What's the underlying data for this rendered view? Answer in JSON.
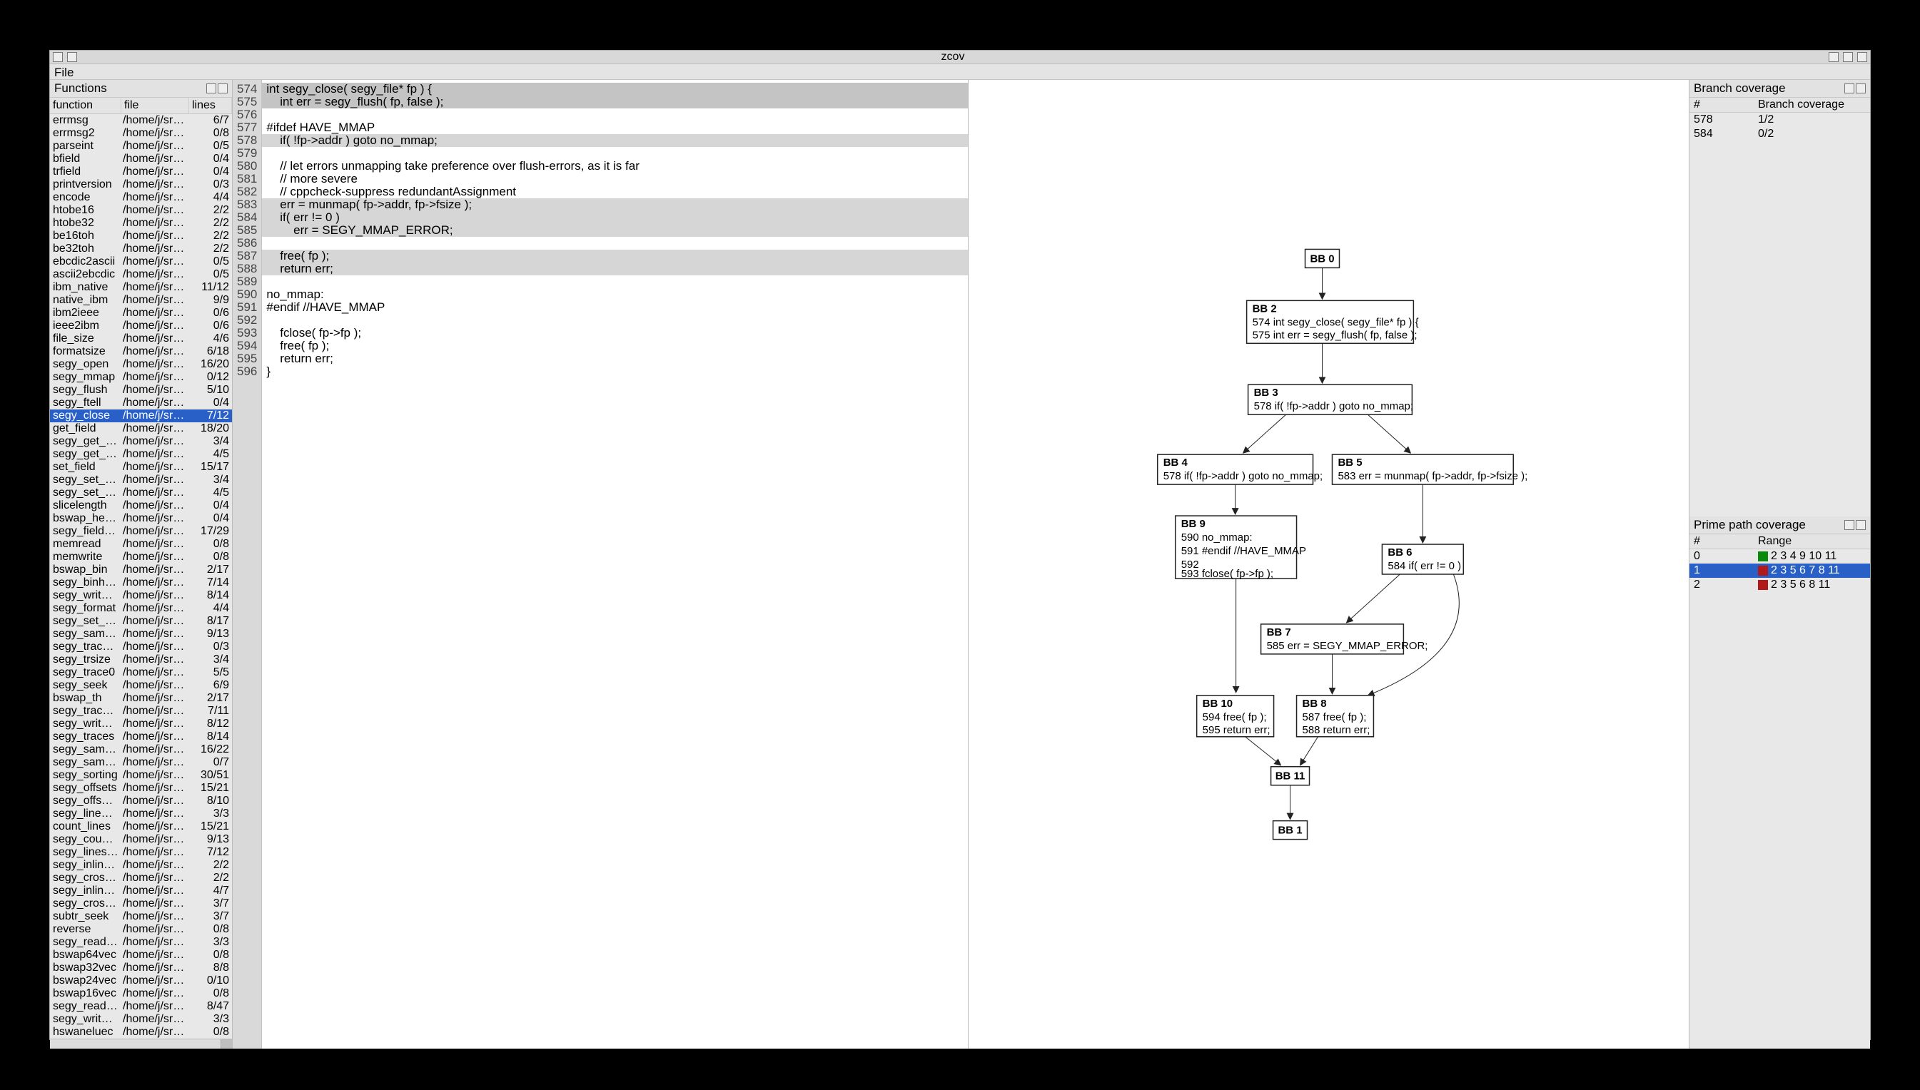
{
  "window": {
    "title": "zcov",
    "menu_file": "File"
  },
  "left": {
    "title": "Functions",
    "columns": {
      "func": "function",
      "file": "file",
      "lines": "lines"
    },
    "file_placeholder": "/home/j/src/s...",
    "selected_index": 23,
    "rows": [
      {
        "f": "errmsg",
        "l": "6/7"
      },
      {
        "f": "errmsg2",
        "l": "0/8"
      },
      {
        "f": "parseint",
        "l": "0/5"
      },
      {
        "f": "bfield",
        "l": "0/4"
      },
      {
        "f": "trfield",
        "l": "0/4"
      },
      {
        "f": "printversion",
        "l": "0/3"
      },
      {
        "f": "encode",
        "l": "4/4"
      },
      {
        "f": "htobe16",
        "l": "2/2"
      },
      {
        "f": "htobe32",
        "l": "2/2"
      },
      {
        "f": "be16toh",
        "l": "2/2"
      },
      {
        "f": "be32toh",
        "l": "2/2"
      },
      {
        "f": "ebcdic2ascii",
        "l": "0/5"
      },
      {
        "f": "ascii2ebcdic",
        "l": "0/5"
      },
      {
        "f": "ibm_native",
        "l": "11/12"
      },
      {
        "f": "native_ibm",
        "l": "9/9"
      },
      {
        "f": "ibm2ieee",
        "l": "0/6"
      },
      {
        "f": "ieee2ibm",
        "l": "0/6"
      },
      {
        "f": "file_size",
        "l": "4/6"
      },
      {
        "f": "formatsize",
        "l": "6/18"
      },
      {
        "f": "segy_open",
        "l": "16/20"
      },
      {
        "f": "segy_mmap",
        "l": "0/12"
      },
      {
        "f": "segy_flush",
        "l": "5/10"
      },
      {
        "f": "segy_ftell",
        "l": "0/4"
      },
      {
        "f": "segy_close",
        "l": "7/12"
      },
      {
        "f": "get_field",
        "l": "18/20"
      },
      {
        "f": "segy_get_field",
        "l": "3/4"
      },
      {
        "f": "segy_get_bfie...",
        "l": "4/5"
      },
      {
        "f": "set_field",
        "l": "15/17"
      },
      {
        "f": "segy_set_field",
        "l": "3/4"
      },
      {
        "f": "segy_set_bfield",
        "l": "4/5"
      },
      {
        "f": "slicelength",
        "l": "0/4"
      },
      {
        "f": "bswap_heade...",
        "l": "0/4"
      },
      {
        "f": "segy_field_for...",
        "l": "17/29"
      },
      {
        "f": "memread",
        "l": "0/8"
      },
      {
        "f": "memwrite",
        "l": "0/8"
      },
      {
        "f": "bswap_bin",
        "l": "2/17"
      },
      {
        "f": "segy_binhea...",
        "l": "7/14"
      },
      {
        "f": "segy_write_bi...",
        "l": "8/14"
      },
      {
        "f": "segy_format",
        "l": "4/4"
      },
      {
        "f": "segy_set_for...",
        "l": "8/17"
      },
      {
        "f": "segy_samples",
        "l": "9/13"
      },
      {
        "f": "segy_trace_b...",
        "l": "0/3"
      },
      {
        "f": "segy_trsize",
        "l": "3/4"
      },
      {
        "f": "segy_trace0",
        "l": "5/5"
      },
      {
        "f": "segy_seek",
        "l": "6/9"
      },
      {
        "f": "bswap_th",
        "l": "2/17"
      },
      {
        "f": "segy_tracehe...",
        "l": "7/11"
      },
      {
        "f": "segy_write_tr...",
        "l": "8/12"
      },
      {
        "f": "segy_traces",
        "l": "8/14"
      },
      {
        "f": "segy_sample_...",
        "l": "16/22"
      },
      {
        "f": "segy_sample...",
        "l": "0/7"
      },
      {
        "f": "segy_sorting",
        "l": "30/51"
      },
      {
        "f": "segy_offsets",
        "l": "15/21"
      },
      {
        "f": "segy_offset_i...",
        "l": "8/10"
      },
      {
        "f": "segy_line_ind...",
        "l": "3/3"
      },
      {
        "f": "count_lines",
        "l": "15/21"
      },
      {
        "f": "segy_count_l...",
        "l": "9/13"
      },
      {
        "f": "segy_lines_co...",
        "l": "7/12"
      },
      {
        "f": "segy_inline_l...",
        "l": "2/2"
      },
      {
        "f": "segy_crosslin...",
        "l": "2/2"
      },
      {
        "f": "segy_inline_i...",
        "l": "4/7"
      },
      {
        "f": "segy_crosslin...",
        "l": "3/7"
      },
      {
        "f": "subtr_seek",
        "l": "3/7"
      },
      {
        "f": "reverse",
        "l": "0/8"
      },
      {
        "f": "segy_readtrace",
        "l": "3/3"
      },
      {
        "f": "bswap64vec",
        "l": "0/8"
      },
      {
        "f": "bswap32vec",
        "l": "8/8"
      },
      {
        "f": "bswap24vec",
        "l": "0/10"
      },
      {
        "f": "bswap16vec",
        "l": "0/8"
      },
      {
        "f": "segy_readsubtr",
        "l": "8/47"
      },
      {
        "f": "segy_writetra...",
        "l": "3/3"
      },
      {
        "f": "hswaneluec",
        "l": "0/8"
      }
    ]
  },
  "code": {
    "start": 574,
    "lines": [
      {
        "t": "int segy_close( segy_file* fp ) {",
        "h": "grey"
      },
      {
        "t": "    int err = segy_flush( fp, false );",
        "h": "grey"
      },
      {
        "t": "",
        "h": ""
      },
      {
        "t": "#ifdef HAVE_MMAP",
        "h": ""
      },
      {
        "t": "    if( !fp->addr ) goto no_mmap;",
        "h": "light"
      },
      {
        "t": "",
        "h": ""
      },
      {
        "t": "    // let errors unmapping take preference over flush-errors, as it is far",
        "h": ""
      },
      {
        "t": "    // more severe",
        "h": ""
      },
      {
        "t": "    // cppcheck-suppress redundantAssignment",
        "h": ""
      },
      {
        "t": "    err = munmap( fp->addr, fp->fsize );",
        "h": "light"
      },
      {
        "t": "    if( err != 0 )",
        "h": "light"
      },
      {
        "t": "        err = SEGY_MMAP_ERROR;",
        "h": "light"
      },
      {
        "t": "",
        "h": ""
      },
      {
        "t": "    free( fp );",
        "h": "light"
      },
      {
        "t": "    return err;",
        "h": "light"
      },
      {
        "t": "",
        "h": ""
      },
      {
        "t": "no_mmap:",
        "h": ""
      },
      {
        "t": "#endif //HAVE_MMAP",
        "h": ""
      },
      {
        "t": "",
        "h": ""
      },
      {
        "t": "    fclose( fp->fp );",
        "h": ""
      },
      {
        "t": "    free( fp );",
        "h": ""
      },
      {
        "t": "    return err;",
        "h": ""
      },
      {
        "t": "}",
        "h": ""
      }
    ]
  },
  "diagram": {
    "nodes": {
      "bb0": "BB 0",
      "bb1": "BB 1",
      "bb2": "BB 2",
      "bb3": "BB 3",
      "bb4": "BB 4",
      "bb5": "BB 5",
      "bb6": "BB 6",
      "bb7": "BB 7",
      "bb8": "BB 8",
      "bb9": "BB 9",
      "bb10": "BB 10",
      "bb11": "BB 11"
    },
    "texts": {
      "bb2a": "574 int segy_close( segy_file* fp ) {",
      "bb2b": "575 int err = segy_flush( fp, false );",
      "bb3a": "578 if( !fp->addr ) goto no_mmap;",
      "bb4a": "578 if( !fp->addr ) goto no_mmap;",
      "bb5a": "583 err = munmap( fp->addr, fp->fsize );",
      "bb6a": "584 if( err != 0 )",
      "bb7a": "585 err = SEGY_MMAP_ERROR;",
      "bb8a": "587 free( fp );",
      "bb8b": "588 return err;",
      "bb9a": "590 no_mmap:",
      "bb9b": "591 #endif //HAVE_MMAP",
      "bb9c": "592",
      "bb9d": "593 fclose( fp->fp );",
      "bb10a": "594 free( fp );",
      "bb10b": "595 return err;"
    }
  },
  "branch": {
    "title": "Branch coverage",
    "cols": {
      "c1": "#",
      "c2": "Branch coverage"
    },
    "rows": [
      {
        "a": "578",
        "b": "1/2"
      },
      {
        "a": "584",
        "b": "0/2"
      }
    ]
  },
  "prime": {
    "title": "Prime path coverage",
    "cols": {
      "c1": "#",
      "c2": "Range"
    },
    "sel": 1,
    "rows": [
      {
        "n": "0",
        "color": "green",
        "r": "2 3 4 9 10 11"
      },
      {
        "n": "1",
        "color": "red",
        "r": "2 3 5 6 7 8 11"
      },
      {
        "n": "2",
        "color": "red",
        "r": "2 3 5 6 8 11"
      }
    ]
  }
}
